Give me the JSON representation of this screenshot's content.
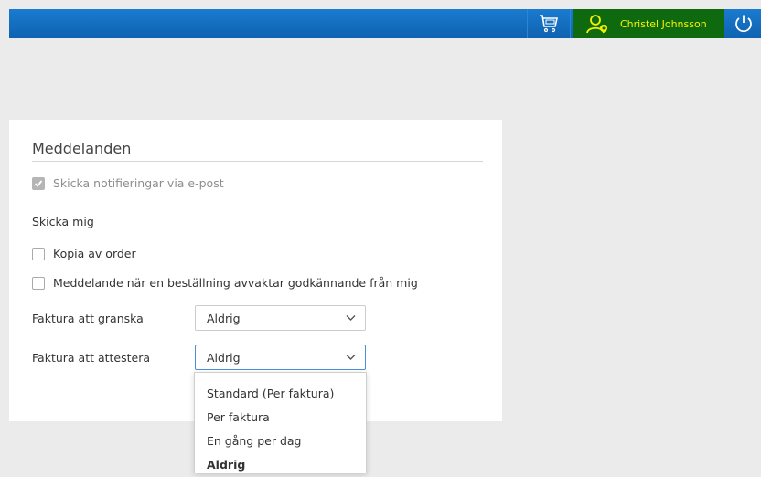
{
  "header": {
    "user_name": "Christel Johnsson",
    "icons": {
      "cart": "shopping-cart-icon",
      "user": "user-settings-icon",
      "power": "power-icon"
    },
    "colors": {
      "bar": "#1a7bd0",
      "user_bg": "#0f6a0f",
      "user_text": "#f2f200"
    }
  },
  "messages": {
    "title": "Meddelanden",
    "email_notify_label": "Skicka notifieringar via e-post",
    "email_notify_checked": true,
    "send_me_label": "Skicka mig",
    "copy_order_label": "Kopia av order",
    "copy_order_checked": false,
    "approval_label": "Meddelande när en beställning avvaktar godkännande från mig",
    "approval_checked": false,
    "invoice_review_label": "Faktura att granska",
    "invoice_review_value": "Aldrig",
    "invoice_attest_label": "Faktura att attestera",
    "invoice_attest_value": "Aldrig"
  },
  "dropdown": {
    "options": [
      "Standard (Per faktura)",
      "Per faktura",
      "En gång per dag",
      "Aldrig"
    ],
    "selected": "Aldrig"
  }
}
